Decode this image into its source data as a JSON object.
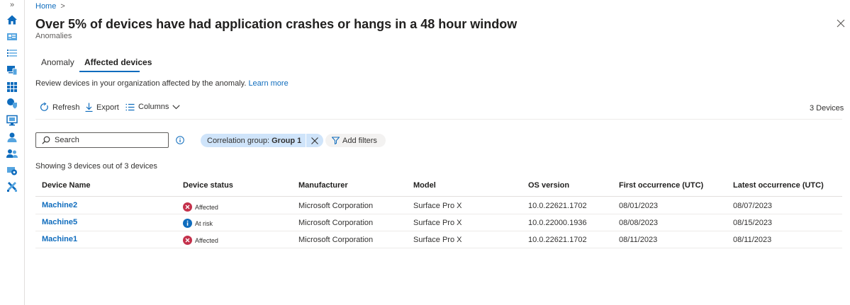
{
  "breadcrumb": {
    "home": "Home",
    "separator": ">"
  },
  "header": {
    "title": "Over 5% of devices have had application crashes or hangs in a 48 hour window",
    "subtitle": "Anomalies",
    "more": "···"
  },
  "tabs": [
    {
      "label": "Anomaly",
      "active": false
    },
    {
      "label": "Affected devices",
      "active": true
    }
  ],
  "description": {
    "text": "Review devices in your organization affected by the anomaly.",
    "link": "Learn more"
  },
  "toolbar": {
    "refresh": "Refresh",
    "export": "Export",
    "columns": "Columns",
    "device_count": "3 Devices"
  },
  "filters": {
    "search_placeholder": "Search",
    "pill_label": "Correlation group:",
    "pill_value": "Group 1",
    "add_filters": "Add filters"
  },
  "showing": "Showing 3 devices out of 3 devices",
  "table": {
    "columns": [
      "Device Name",
      "Device status",
      "Manufacturer",
      "Model",
      "OS version",
      "First occurrence (UTC)",
      "Latest occurrence (UTC)"
    ],
    "rows": [
      {
        "name": "Machine2",
        "status": "Affected",
        "status_type": "error",
        "manufacturer": "Microsoft Corporation",
        "model": "Surface Pro X",
        "os": "10.0.22621.1702",
        "first": "08/01/2023",
        "latest": "08/07/2023"
      },
      {
        "name": "Machine5",
        "status": "At risk",
        "status_type": "info",
        "manufacturer": "Microsoft Corporation",
        "model": "Surface Pro X",
        "os": "10.0.22000.1936",
        "first": "08/08/2023",
        "latest": "08/15/2023"
      },
      {
        "name": "Machine1",
        "status": "Affected",
        "status_type": "error",
        "manufacturer": "Microsoft Corporation",
        "model": "Surface Pro X",
        "os": "10.0.22621.1702",
        "first": "08/11/2023",
        "latest": "08/11/2023"
      }
    ]
  },
  "colors": {
    "accent": "#0f6cbd",
    "error": "#c4314b",
    "info": "#0f6cbd",
    "pill": "#cfe4fa"
  },
  "rail_icons": [
    "home-icon",
    "dashboard-icon",
    "list-icon",
    "devices-icon",
    "apps-icon",
    "security-icon",
    "monitor-icon",
    "user-icon",
    "groups-icon",
    "tenant-admin-icon",
    "troubleshooting-icon"
  ]
}
